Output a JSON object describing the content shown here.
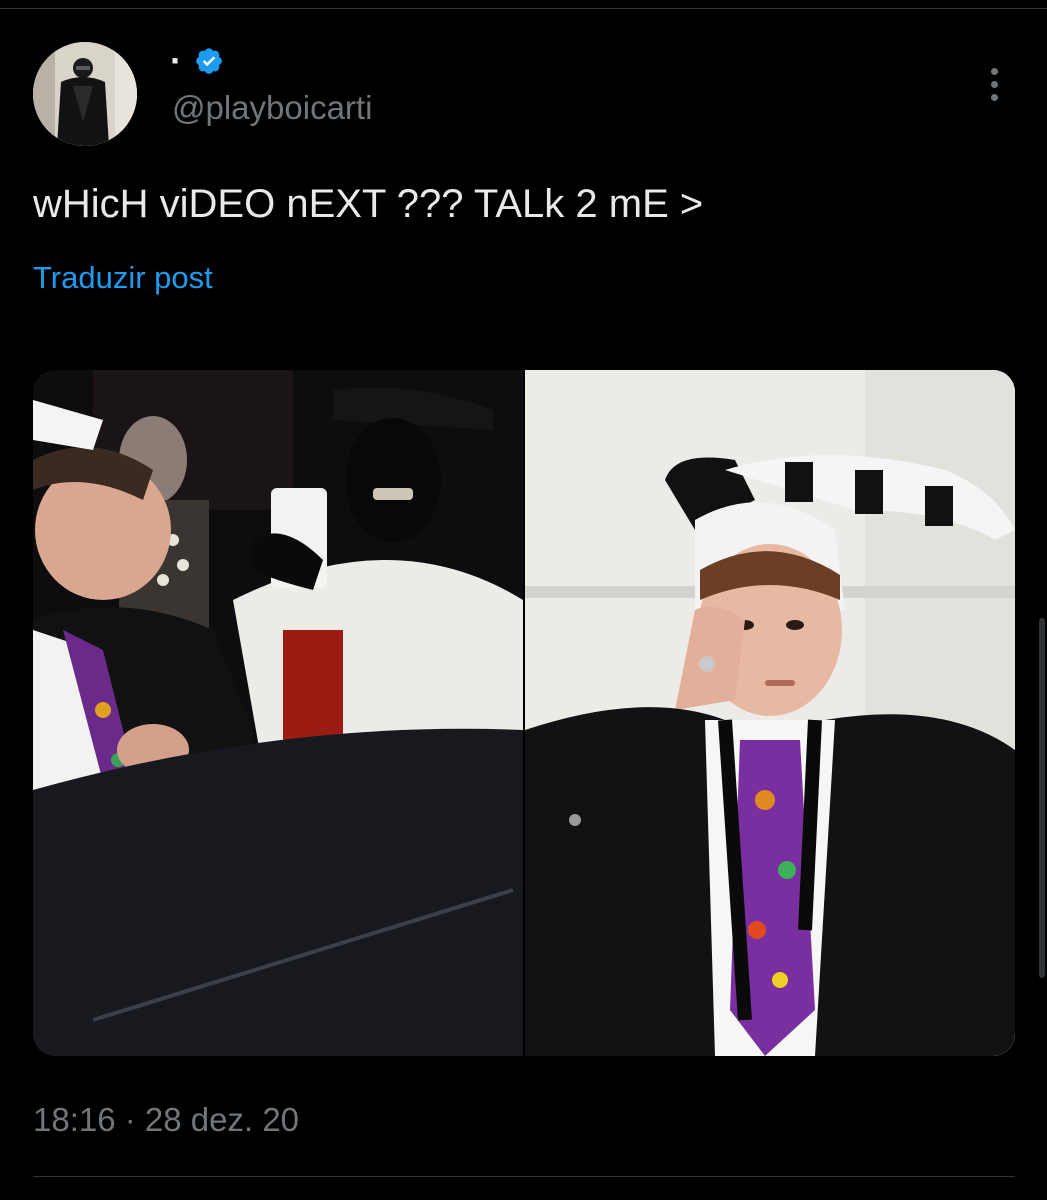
{
  "author": {
    "display_name": "·",
    "handle": "@playboicarti",
    "verified_icon": "verified-badge-icon",
    "avatar_icon": "avatar-photo"
  },
  "post": {
    "text": "wHicH viDEO nEXT ??? TALk 2 mE >",
    "translate_label": "Traduzir post",
    "timestamp": "18:16 · 28 dez. 20"
  },
  "media": {
    "photos": [
      {
        "icon": "party-photo"
      },
      {
        "icon": "portrait-jester-hat-photo"
      }
    ]
  },
  "colors": {
    "background": "#000000",
    "text_primary": "#e7e9ea",
    "text_secondary": "#71767b",
    "accent": "#1d9bf0",
    "divider": "#2f3336"
  }
}
